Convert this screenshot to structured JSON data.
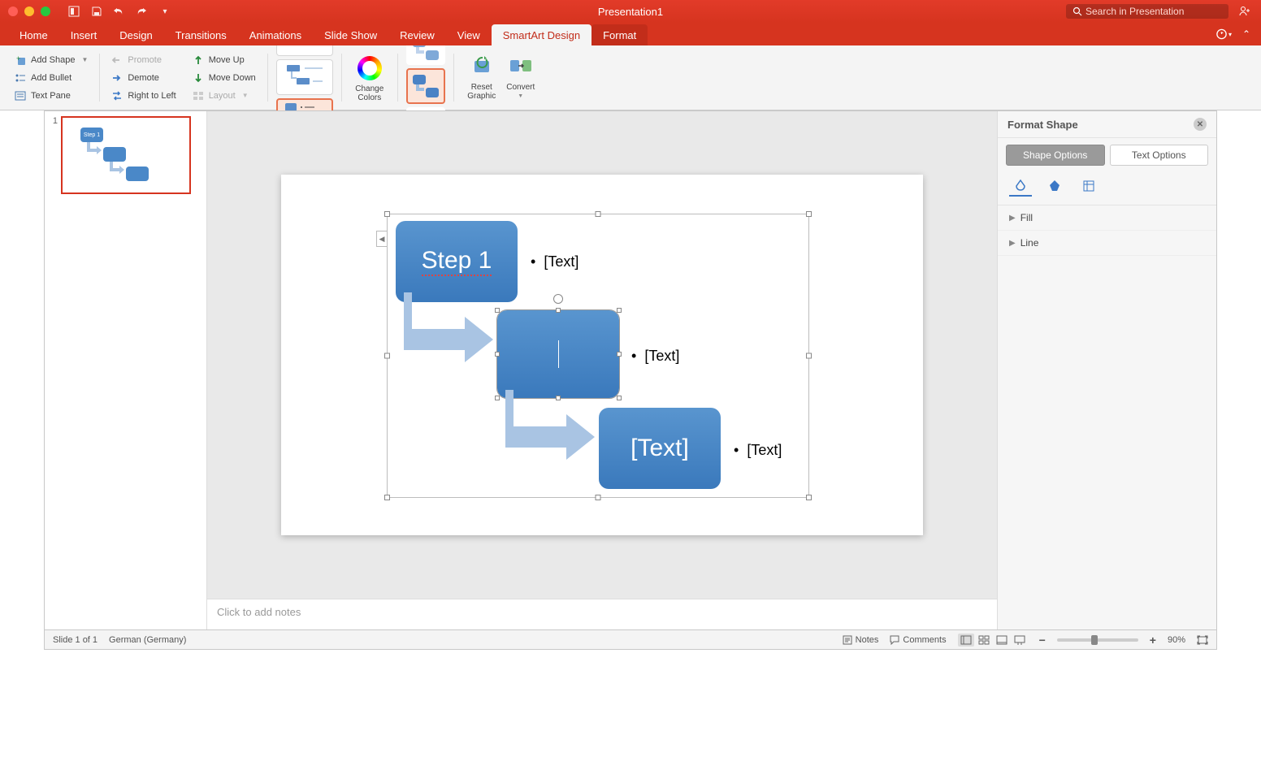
{
  "window": {
    "title": "Presentation1",
    "search_placeholder": "Search in Presentation"
  },
  "tabs": [
    "Home",
    "Insert",
    "Design",
    "Transitions",
    "Animations",
    "Slide Show",
    "Review",
    "View",
    "SmartArt Design",
    "Format"
  ],
  "active_tab": "SmartArt Design",
  "ribbon": {
    "add_shape": "Add Shape",
    "add_bullet": "Add Bullet",
    "text_pane": "Text Pane",
    "promote": "Promote",
    "demote": "Demote",
    "right_to_left": "Right to Left",
    "move_up": "Move Up",
    "move_down": "Move Down",
    "layout": "Layout",
    "change_colors": "Change\nColors",
    "reset_graphic": "Reset\nGraphic",
    "convert": "Convert"
  },
  "thumb_number": "1",
  "smartart": {
    "step1": "Step 1",
    "placeholder": "[Text]",
    "bullet_placeholder": "[Text]"
  },
  "notes_placeholder": "Click to add notes",
  "format_pane": {
    "title": "Format Shape",
    "shape_options": "Shape Options",
    "text_options": "Text Options",
    "fill": "Fill",
    "line": "Line"
  },
  "status": {
    "slide": "Slide 1 of 1",
    "lang": "German (Germany)",
    "notes": "Notes",
    "comments": "Comments",
    "zoom": "90%"
  }
}
